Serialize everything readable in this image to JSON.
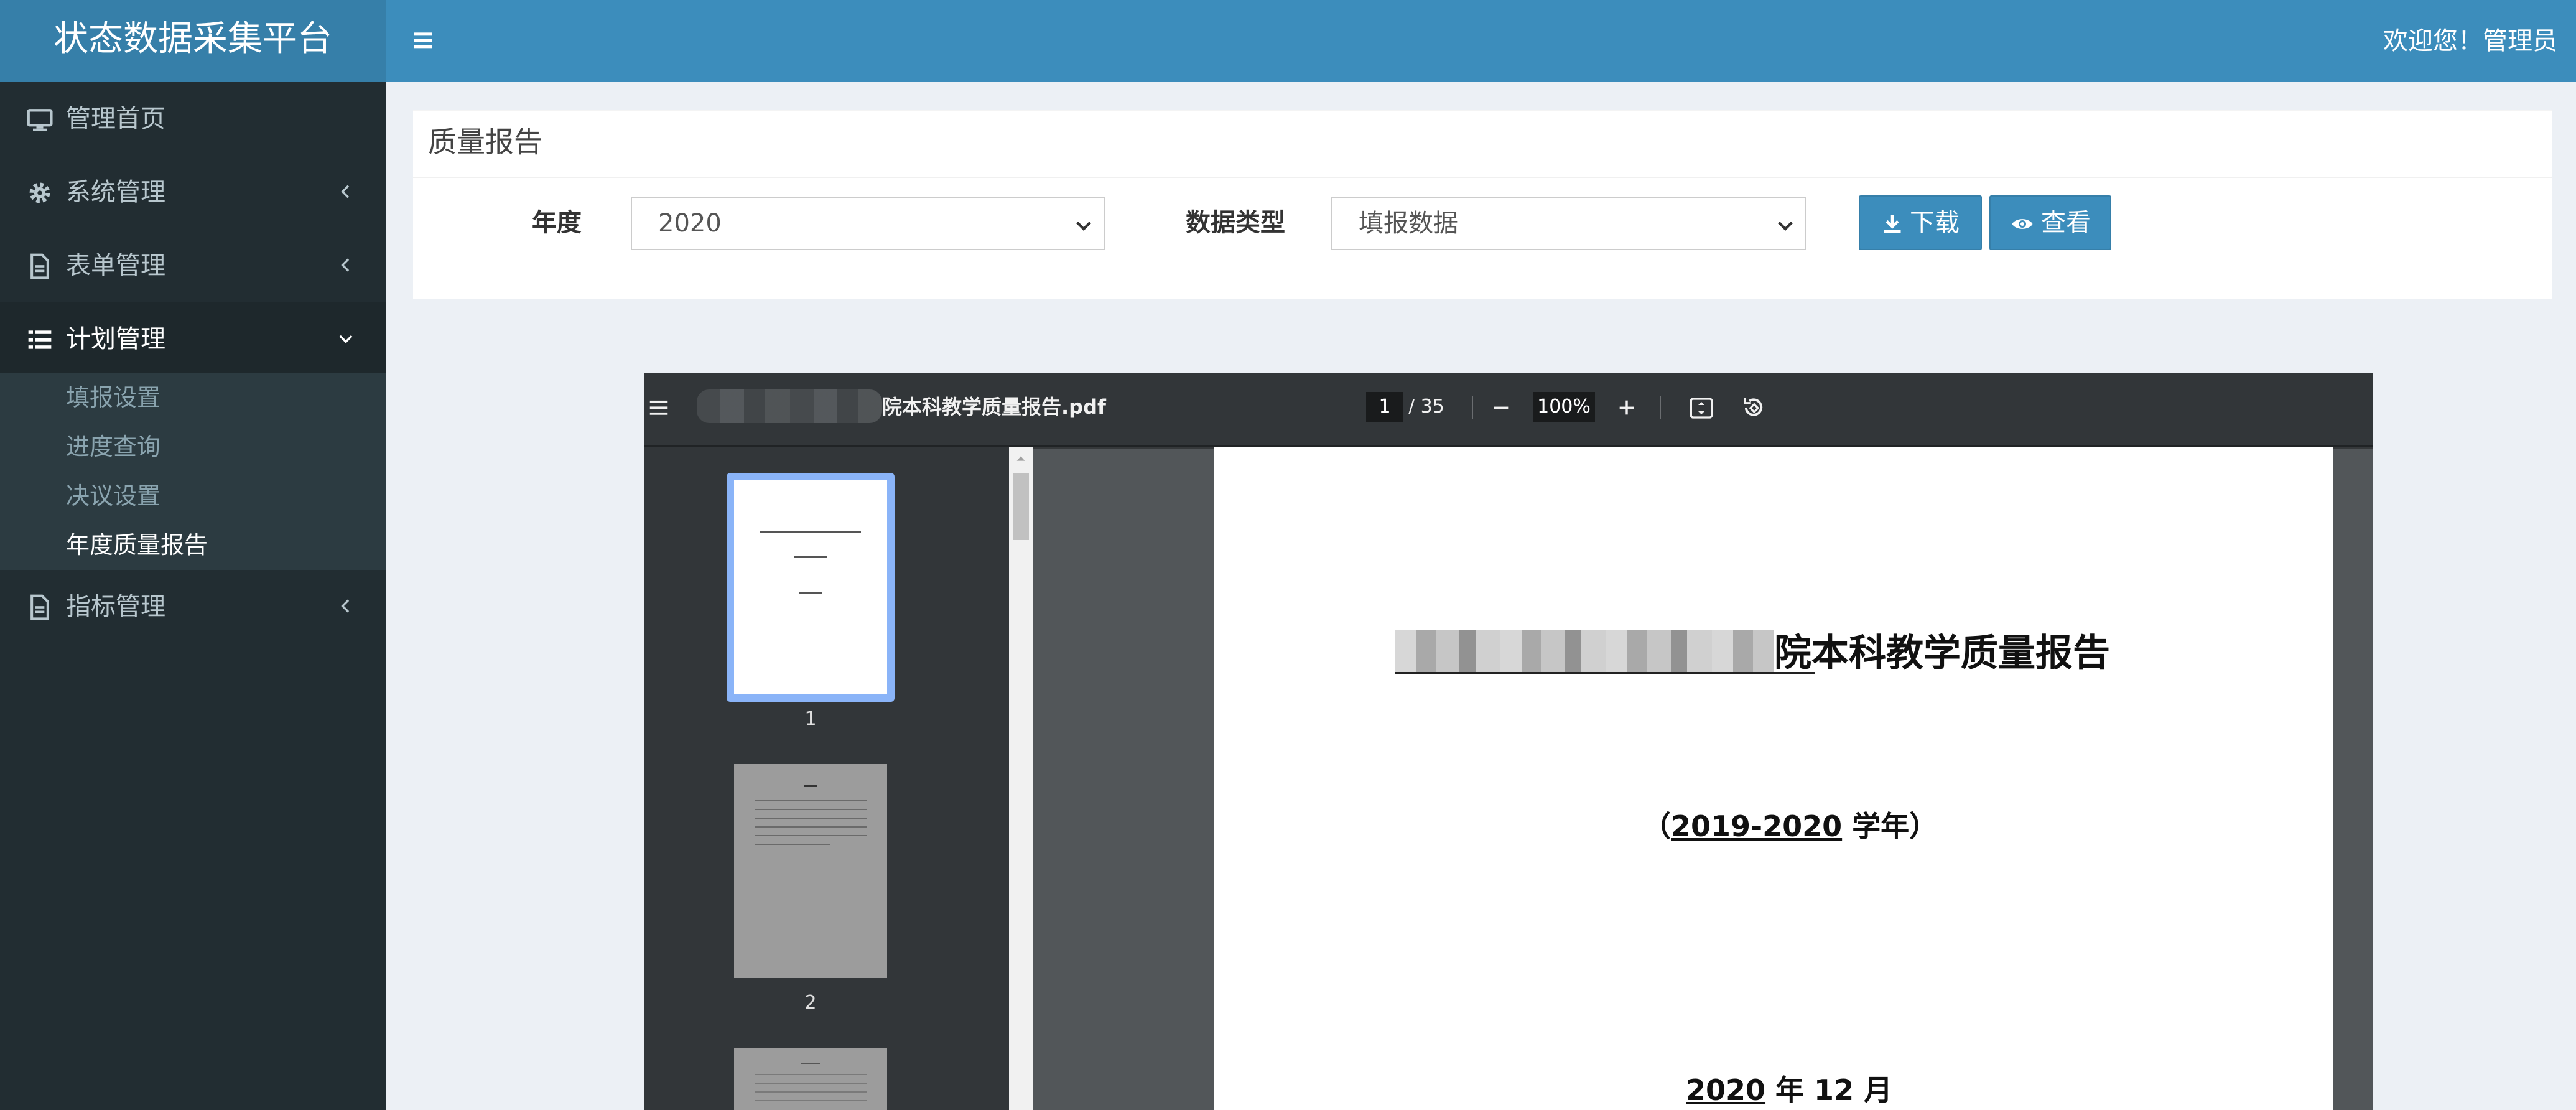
{
  "app": {
    "title": "状态数据采集平台"
  },
  "header": {
    "welcome": "欢迎您！管理员"
  },
  "sidebar": {
    "items": [
      {
        "label": "管理首页"
      },
      {
        "label": "系统管理"
      },
      {
        "label": "表单管理"
      },
      {
        "label": "计划管理"
      },
      {
        "label": "指标管理"
      }
    ],
    "submenu": [
      {
        "label": "填报设置"
      },
      {
        "label": "进度查询"
      },
      {
        "label": "决议设置"
      },
      {
        "label": "年度质量报告"
      }
    ]
  },
  "report": {
    "title": "质量报告",
    "year_label": "年度",
    "year_value": "2020",
    "type_label": "数据类型",
    "type_value": "填报数据",
    "download_label": "下载",
    "view_label": "查看"
  },
  "viewer": {
    "filename": "院本科教学质量报告.pdf",
    "current_page": "1",
    "total_pages": "/ 35",
    "zoom": "100%",
    "thumbnails": [
      "1",
      "2"
    ]
  },
  "document": {
    "title": "院本科教学质量报告",
    "year_open": "（",
    "year_range": "2019-2020",
    "year_suffix": " 学年）",
    "date_year": "2020",
    "date_suffix": " 年 12 月"
  },
  "colors": {
    "header": "#3c8dbc",
    "logo": "#367fa9",
    "sidebar": "#222d32",
    "viewer_toolbar": "#323639",
    "viewer_bg": "#525659",
    "thumb_selected": "#8ab4f8"
  }
}
